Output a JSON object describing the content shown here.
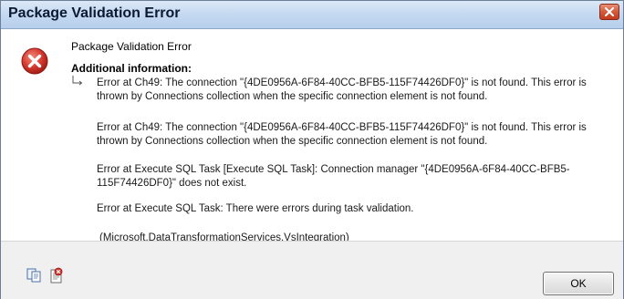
{
  "window": {
    "title": "Package Validation Error",
    "close_icon": "close-icon"
  },
  "dialog": {
    "heading": "Package Validation Error",
    "subheading": "Additional information:",
    "icons": {
      "error": "error-icon",
      "arrow": "return-arrow-icon",
      "copy": "copy-icon",
      "details": "show-details-icon"
    },
    "messages": [
      "Error at Ch49: The connection \"{4DE0956A-6F84-40CC-BFB5-115F74426DF0}\" is not found. This error is thrown by Connections collection when the specific connection element is not found.",
      "Error at Ch49: The connection \"{4DE0956A-6F84-40CC-BFB5-115F74426DF0}\" is not found. This error is thrown by Connections collection when the specific connection element is not found.",
      "Error at Execute SQL Task [Execute SQL Task]: Connection manager \"{4DE0956A-6F84-40CC-BFB5-115F74426DF0}\" does not exist.",
      "Error at Execute SQL Task: There were errors during task validation.",
      "(Microsoft.DataTransformationServices.VsIntegration)"
    ],
    "ok_label": "OK"
  },
  "colors": {
    "titlebar": "#c6daf1",
    "close_button": "#d45a3b",
    "error_red": "#d63a2f",
    "footer": "#f0f0f0"
  }
}
